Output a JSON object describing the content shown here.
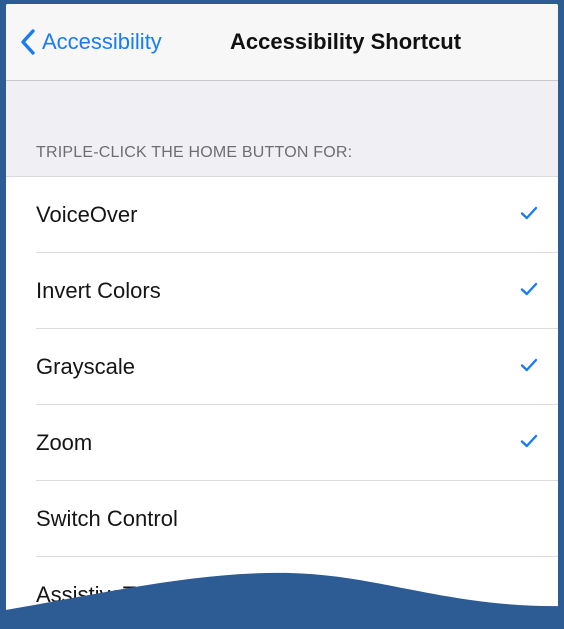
{
  "nav": {
    "back_label": "Accessibility",
    "title": "Accessibility Shortcut"
  },
  "section": {
    "header": "TRIPLE-CLICK THE HOME BUTTON FOR:"
  },
  "options": [
    {
      "label": "VoiceOver",
      "checked": true
    },
    {
      "label": "Invert Colors",
      "checked": true
    },
    {
      "label": "Grayscale",
      "checked": true
    },
    {
      "label": "Zoom",
      "checked": true
    },
    {
      "label": "Switch Control",
      "checked": false
    },
    {
      "label": "AssistiveTouch",
      "checked": false
    }
  ],
  "colors": {
    "accent": "#1a7cf3",
    "frame": "#2d5c95",
    "background": "#efeff4"
  }
}
